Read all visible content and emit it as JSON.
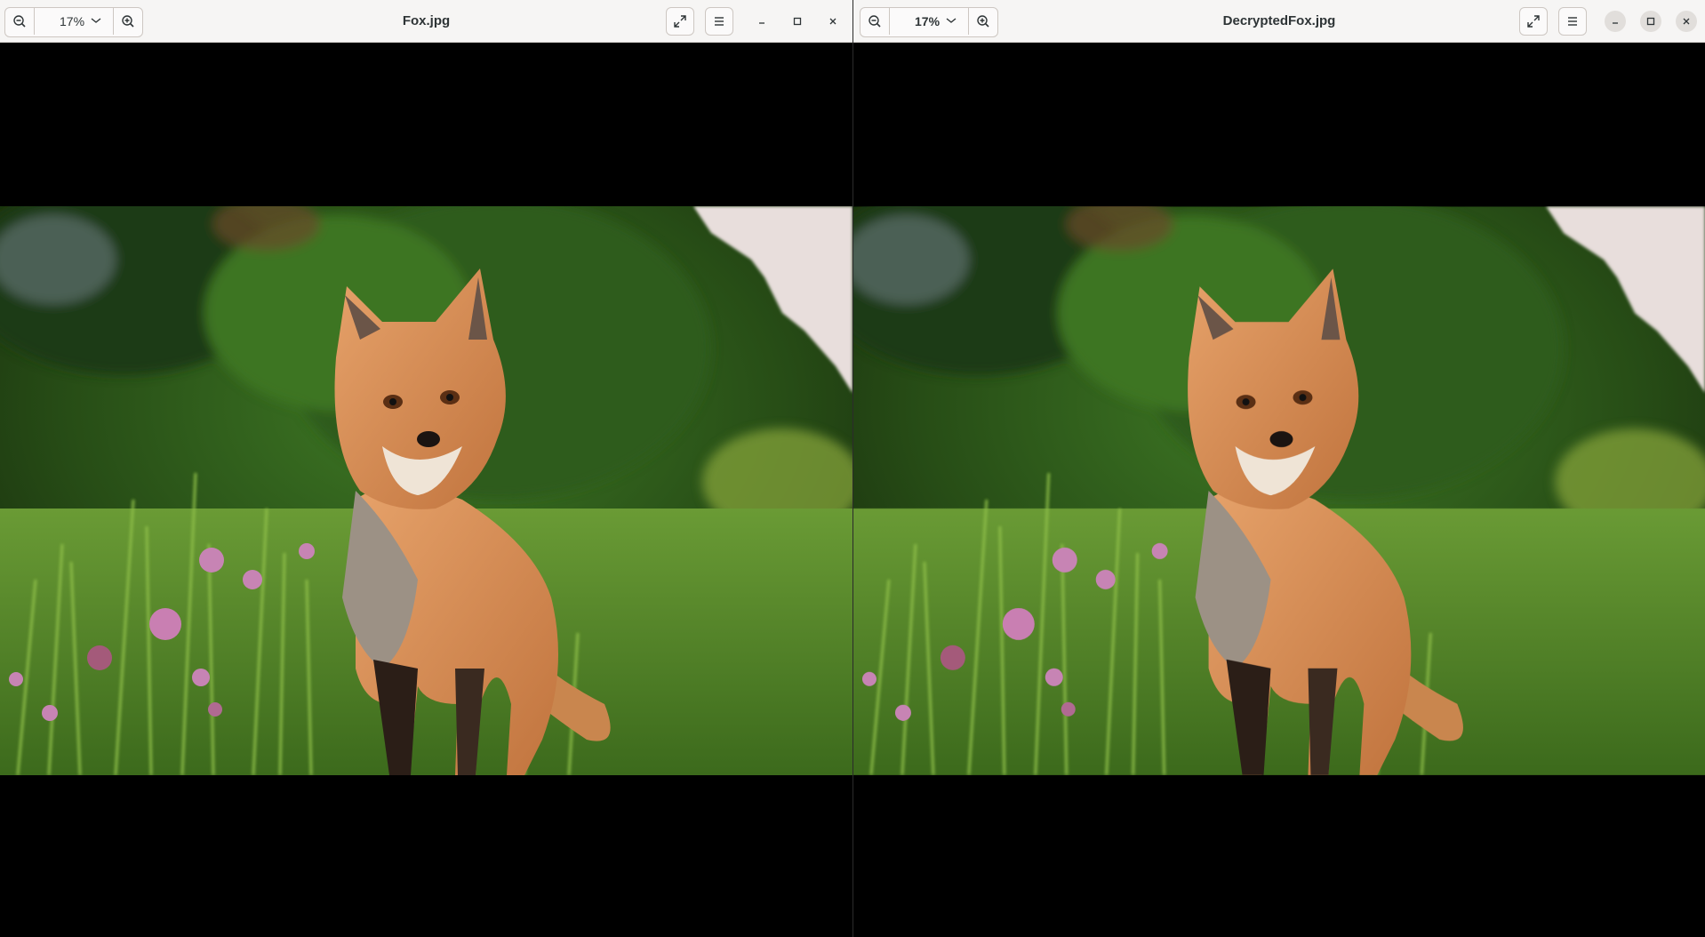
{
  "windows": [
    {
      "title": "Fox.jpg",
      "zoom_value": "17%",
      "icons": {
        "zoom_out": "zoom-out-icon",
        "zoom_in": "zoom-in-icon",
        "dropdown": "chevron-down-icon",
        "fullscreen": "fullscreen-icon",
        "menu": "hamburger-menu-icon",
        "minimize": "minimize-icon",
        "maximize": "maximize-icon",
        "close": "close-icon"
      },
      "image_subject": "red fox standing in green grass with pink clover flowers"
    },
    {
      "title": "DecryptedFox.jpg",
      "zoom_value": "17%",
      "icons": {
        "zoom_out": "zoom-out-icon",
        "zoom_in": "zoom-in-icon",
        "dropdown": "chevron-down-icon",
        "fullscreen": "fullscreen-icon",
        "menu": "hamburger-menu-icon",
        "minimize": "minimize-icon",
        "maximize": "maximize-icon",
        "close": "close-icon"
      },
      "image_subject": "red fox standing in green grass with pink clover flowers"
    }
  ],
  "colors": {
    "headerbar": "#f6f5f4",
    "canvas": "#000000",
    "text": "#2e3436"
  }
}
